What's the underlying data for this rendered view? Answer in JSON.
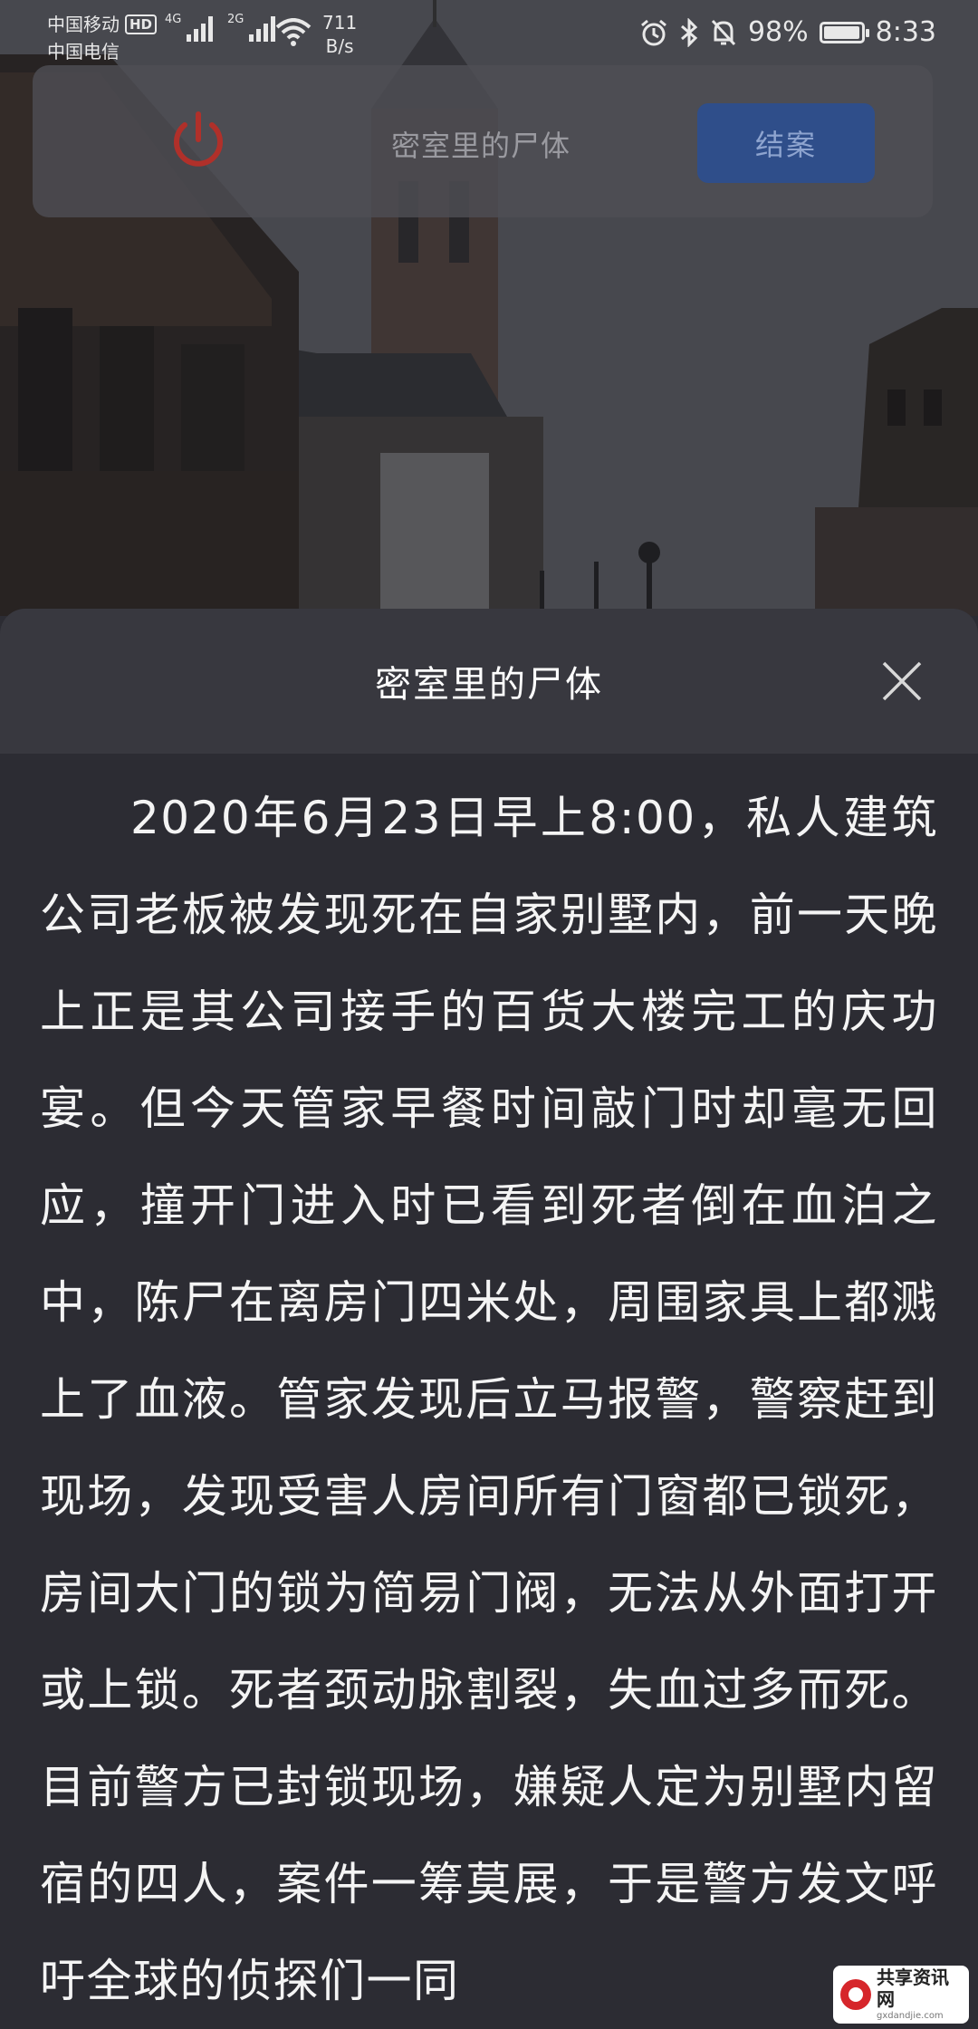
{
  "status_bar": {
    "carrier_1": "中国移动",
    "carrier_1_badge": "HD",
    "carrier_2": "中国电信",
    "signal_1_tag": "4G",
    "signal_2_tag": "2G",
    "net_speed_value": "711",
    "net_speed_unit": "B/s",
    "battery_percent": "98%",
    "battery_level": 0.98,
    "time": "8:33",
    "icons": [
      "alarm-icon",
      "bluetooth-icon",
      "mute-bell-icon",
      "battery-icon",
      "wifi-icon",
      "signal-icon"
    ]
  },
  "toolbar": {
    "title": "密室里的尸体",
    "close_case_label": "结案",
    "icons": [
      "power-icon"
    ]
  },
  "sheet": {
    "title": "密室里的尸体",
    "close_icon": "close-icon",
    "story_text": "2020年6月23日早上8:00，私人建筑公司老板被发现死在自家别墅内，前一天晚上正是其公司接手的百货大楼完工的庆功宴。但今天管家早餐时间敲门时却毫无回应，撞开门进入时已看到死者倒在血泊之中，陈尸在离房门四米处，周围家具上都溅上了血液。管家发现后立马报警，警察赶到现场，发现受害人房间所有门窗都已锁死，房间大门的锁为简易门阀，无法从外面打开或上锁。死者颈动脉割裂，失血过多而死。目前警方已封锁现场，嫌疑人定为别墅内留宿的四人，案件一筹莫展，于是警方发文呼吁全球的侦探们一同"
  },
  "watermark": {
    "text": "共享资讯网",
    "sub_text": "gxdandjie.com"
  },
  "colors": {
    "sheet_bg": "#2c2c33",
    "sheet_header_bg": "#38383f",
    "button_blue": "#2f4e8a",
    "power_red": "#c0392b",
    "text_white": "#f4f4f4"
  }
}
